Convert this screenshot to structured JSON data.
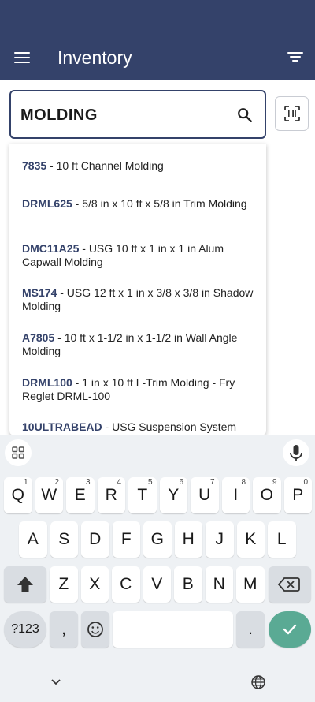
{
  "app_bar": {
    "title": "Inventory",
    "color": "#34426a"
  },
  "search": {
    "value": "MOLDING"
  },
  "suggestions": [
    {
      "code": "7835",
      "desc": " - 10 ft Channel Molding"
    },
    {
      "code": "DRML625",
      "desc": " - 5/8 in x 10 ft x 5/8 in Trim Molding"
    },
    {
      "code": "DMC11A25",
      "desc": " - USG 10 ft x 1 in x 1 in Alum Capwall Molding"
    },
    {
      "code": "MS174",
      "desc": " - USG 12 ft x 1 in x 3/8 x 3/8 in Shadow Molding"
    },
    {
      "code": "A7805",
      "desc": " - 10 ft x 1-1/2 in x 1-1/2 in Wall Angle Molding"
    },
    {
      "code": "DRML100",
      "desc": " - 1 in x 10 ft L-Trim Molding - Fry Reglet DRML-100"
    },
    {
      "code": "10ULTRABEAD",
      "desc": " - USG Suspension System"
    }
  ],
  "keyboard": {
    "row1": [
      {
        "k": "Q",
        "h": "1"
      },
      {
        "k": "W",
        "h": "2"
      },
      {
        "k": "E",
        "h": "3"
      },
      {
        "k": "R",
        "h": "4"
      },
      {
        "k": "T",
        "h": "5"
      },
      {
        "k": "Y",
        "h": "6"
      },
      {
        "k": "U",
        "h": "7"
      },
      {
        "k": "I",
        "h": "8"
      },
      {
        "k": "O",
        "h": "9"
      },
      {
        "k": "P",
        "h": "0"
      }
    ],
    "row2": [
      "A",
      "S",
      "D",
      "F",
      "G",
      "H",
      "J",
      "K",
      "L"
    ],
    "row3": [
      "Z",
      "X",
      "C",
      "V",
      "B",
      "N",
      "M"
    ],
    "symbols_label": "?123",
    "comma": ",",
    "period": ".",
    "accent_color": "#5aaa94"
  }
}
